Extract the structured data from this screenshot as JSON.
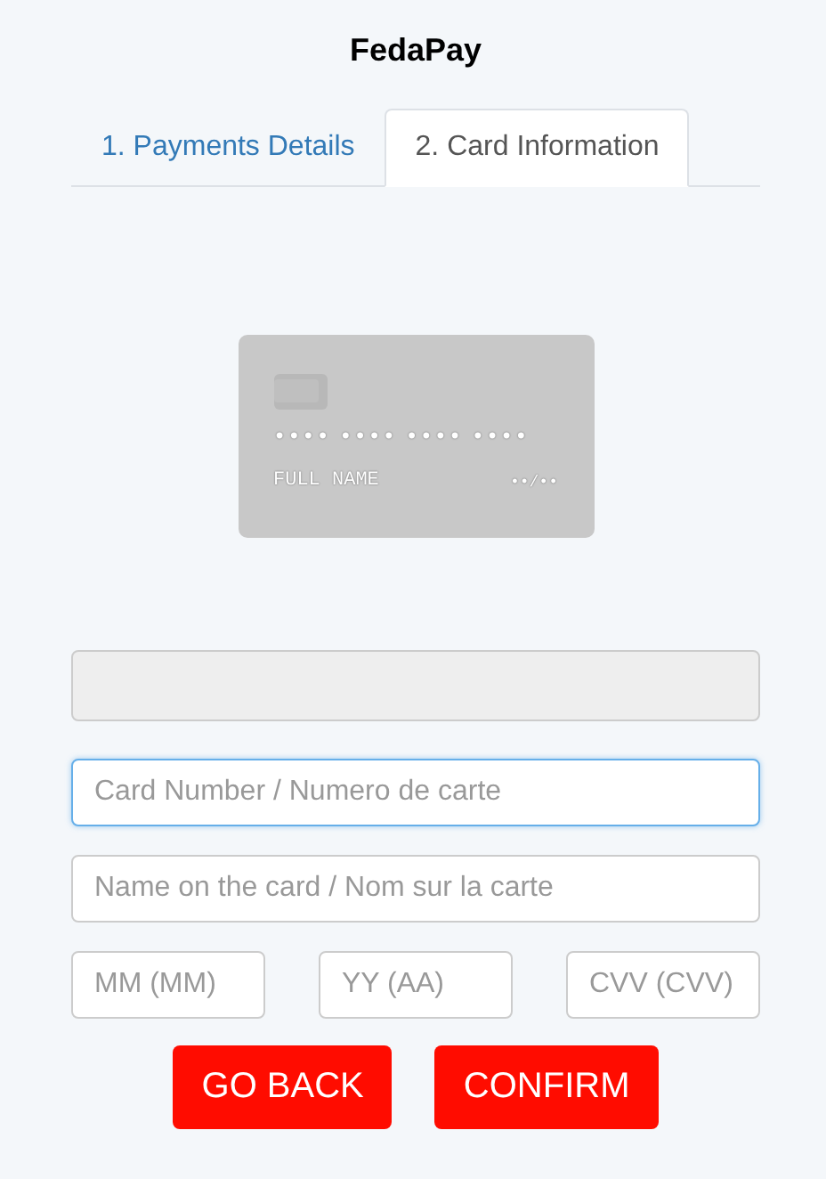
{
  "title": "FedaPay",
  "tabs": [
    {
      "label": "1. Payments Details",
      "selected": false
    },
    {
      "label": "2. Card Information",
      "selected": true
    }
  ],
  "card_preview": {
    "number": "•••• •••• •••• ••••",
    "name": "FULL NAME",
    "expiry": "••/••"
  },
  "fields": [
    {
      "kind": "blank",
      "disabled": true
    },
    {
      "kind": "full",
      "placeholder": "Card Number / Numero de carte",
      "focused": true
    },
    {
      "kind": "full",
      "placeholder": "Name on the card / Nom sur la carte",
      "focused": false
    },
    {
      "kind": "short",
      "placeholder": "MM (MM)",
      "focused": false
    },
    {
      "kind": "short",
      "placeholder": "YY (AA)",
      "focused": false
    },
    {
      "kind": "short",
      "placeholder": "CVV (CVV)",
      "focused": false
    }
  ],
  "buttons": [
    "GO BACK",
    "CONFIRM"
  ]
}
